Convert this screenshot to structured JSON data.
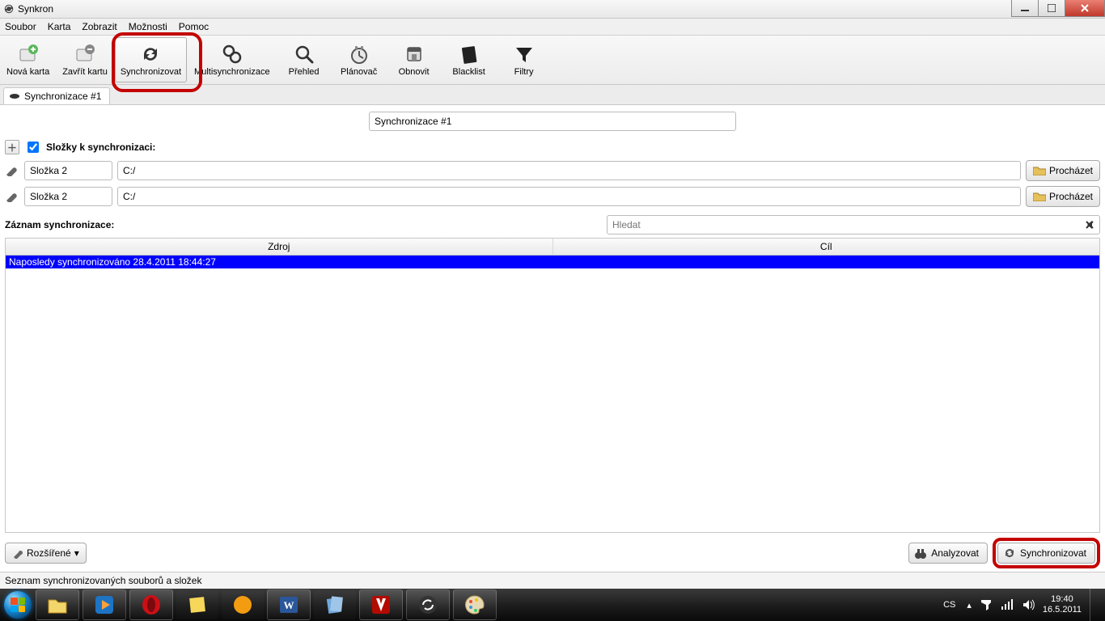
{
  "window": {
    "title": "Synkron"
  },
  "menu": {
    "items": [
      "Soubor",
      "Karta",
      "Zobrazit",
      "Možnosti",
      "Pomoc"
    ]
  },
  "toolbar": {
    "items": [
      {
        "label": "Nová karta",
        "icon": "new-tab-icon"
      },
      {
        "label": "Zavřít kartu",
        "icon": "close-tab-icon"
      },
      {
        "label": "Synchronizovat",
        "icon": "sync-icon",
        "active": true
      },
      {
        "label": "Multisynchronizace",
        "icon": "multisync-icon"
      },
      {
        "label": "Přehled",
        "icon": "overview-icon"
      },
      {
        "label": "Plánovač",
        "icon": "scheduler-icon"
      },
      {
        "label": "Obnovit",
        "icon": "restore-icon"
      },
      {
        "label": "Blacklist",
        "icon": "blacklist-icon"
      },
      {
        "label": "Filtry",
        "icon": "filters-icon"
      }
    ]
  },
  "tab": {
    "label": "Synchronizace #1"
  },
  "sync": {
    "name_value": "Synchronizace #1",
    "folders_header": "Složky k synchronizaci:",
    "rows": [
      {
        "name": "Složka 2",
        "path": "C:/",
        "browse": "Procházet"
      },
      {
        "name": "Složka 2",
        "path": "C:/",
        "browse": "Procházet"
      }
    ],
    "log_label": "Záznam synchronizace:",
    "search_placeholder": "Hledat",
    "grid": {
      "headers": [
        "Zdroj",
        "Cíl"
      ],
      "rows": [
        "Naposledy synchronizováno 28.4.2011 18:44:27"
      ]
    },
    "advanced": "Rozšířené",
    "analyze": "Analyzovat",
    "synchronize": "Synchronizovat"
  },
  "statusbar": {
    "text": "Seznam synchronizovaných souborů a složek"
  },
  "taskbar": {
    "tray": {
      "lang": "CS",
      "time": "19:40",
      "date": "16.5.2011"
    }
  }
}
